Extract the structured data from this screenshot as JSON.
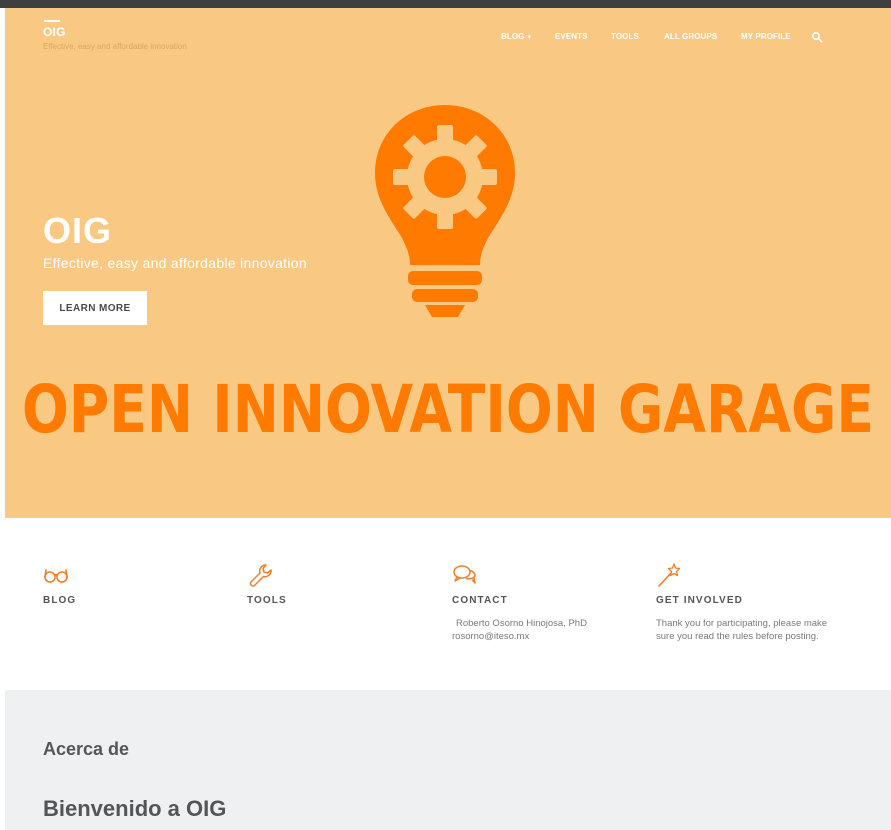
{
  "site": {
    "logo": "OIG",
    "tagline": "Effective, easy and affordable innovation"
  },
  "nav": {
    "items": [
      "BLOG",
      "EVENTS",
      "TOOLS",
      "ALL GROUPS",
      "MY PROFILE"
    ],
    "search_icon": "search-icon"
  },
  "hero": {
    "title": "OIG",
    "subtitle": "Effective, easy and affordable innovation",
    "button_label": "LEARN MORE",
    "banner_text": "OPEN INNOVATION GARAGE",
    "banner_icon": "lightbulb-gear-icon",
    "colors": {
      "background": "#f9c882",
      "accent": "#ff7a00"
    }
  },
  "features": [
    {
      "icon": "glasses-icon",
      "title": "BLOG",
      "lines": []
    },
    {
      "icon": "wrench-icon",
      "title": "TOOLS",
      "lines": []
    },
    {
      "icon": "chat-bubbles-icon",
      "title": "CONTACT",
      "lines": [
        "Roberto Osorno Hinojosa, PhD",
        "rosorno@iteso.mx"
      ]
    },
    {
      "icon": "magic-wand-icon",
      "title": "GET INVOLVED",
      "lines": [
        "Thank you for participating, please make",
        "sure you read the rules before posting."
      ]
    }
  ],
  "about": {
    "heading": "Acerca de",
    "welcome": "Bienvenido a OIG"
  }
}
